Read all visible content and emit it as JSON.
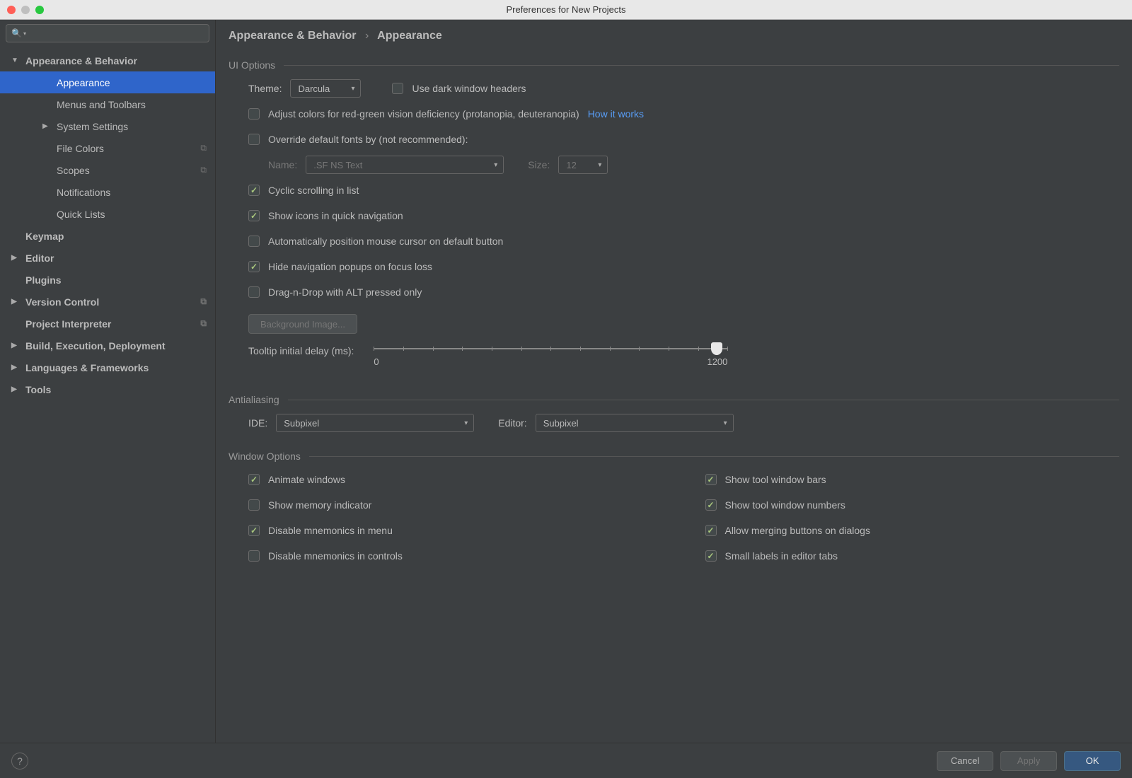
{
  "window": {
    "title": "Preferences for New Projects"
  },
  "search": {
    "placeholder": ""
  },
  "sidebar": {
    "items": [
      {
        "label": "Appearance & Behavior",
        "bold": true,
        "arrow": "down",
        "indent": 0
      },
      {
        "label": "Appearance",
        "indent": 2,
        "selected": true
      },
      {
        "label": "Menus and Toolbars",
        "indent": 2
      },
      {
        "label": "System Settings",
        "indent": 2,
        "arrow": "right"
      },
      {
        "label": "File Colors",
        "indent": 2,
        "badge": true
      },
      {
        "label": "Scopes",
        "indent": 2,
        "badge": true
      },
      {
        "label": "Notifications",
        "indent": 2
      },
      {
        "label": "Quick Lists",
        "indent": 2
      },
      {
        "label": "Keymap",
        "bold": true,
        "indent": 0,
        "noarrow": true
      },
      {
        "label": "Editor",
        "bold": true,
        "arrow": "right",
        "indent": 0
      },
      {
        "label": "Plugins",
        "bold": true,
        "indent": 0,
        "noarrow": true
      },
      {
        "label": "Version Control",
        "bold": true,
        "arrow": "right",
        "indent": 0,
        "badge": true
      },
      {
        "label": "Project Interpreter",
        "bold": true,
        "indent": 0,
        "noarrow": true,
        "badge": true
      },
      {
        "label": "Build, Execution, Deployment",
        "bold": true,
        "arrow": "right",
        "indent": 0
      },
      {
        "label": "Languages & Frameworks",
        "bold": true,
        "arrow": "right",
        "indent": 0
      },
      {
        "label": "Tools",
        "bold": true,
        "arrow": "right",
        "indent": 0
      }
    ]
  },
  "breadcrumb": {
    "root": "Appearance & Behavior",
    "leaf": "Appearance"
  },
  "sections": {
    "ui_options": "UI Options",
    "antialiasing": "Antialiasing",
    "window_options": "Window Options"
  },
  "ui": {
    "theme_label": "Theme:",
    "theme_value": "Darcula",
    "dark_headers": "Use dark window headers",
    "adjust_colors": "Adjust colors for red-green vision deficiency (protanopia, deuteranopia)",
    "how_it_works": "How it works",
    "override_fonts": "Override default fonts by (not recommended):",
    "font_name_label": "Name:",
    "font_name_value": ".SF NS Text",
    "font_size_label": "Size:",
    "font_size_value": "12",
    "cyclic": "Cyclic scrolling in list",
    "quick_nav_icons": "Show icons in quick navigation",
    "auto_mouse": "Automatically position mouse cursor on default button",
    "hide_popups": "Hide navigation popups on focus loss",
    "dnd_alt": "Drag-n-Drop with ALT pressed only",
    "bg_image": "Background Image...",
    "tooltip_label": "Tooltip initial delay (ms):",
    "slider_min": "0",
    "slider_max": "1200"
  },
  "aa": {
    "ide_label": "IDE:",
    "ide_value": "Subpixel",
    "editor_label": "Editor:",
    "editor_value": "Subpixel"
  },
  "wo": {
    "animate": "Animate windows",
    "memory": "Show memory indicator",
    "disable_menu_mnemonics": "Disable mnemonics in menu",
    "disable_control_mnemonics": "Disable mnemonics in controls",
    "tool_bars": "Show tool window bars",
    "tool_numbers": "Show tool window numbers",
    "merge_buttons": "Allow merging buttons on dialogs",
    "small_labels": "Small labels in editor tabs"
  },
  "footer": {
    "cancel": "Cancel",
    "apply": "Apply",
    "ok": "OK",
    "help": "?"
  }
}
